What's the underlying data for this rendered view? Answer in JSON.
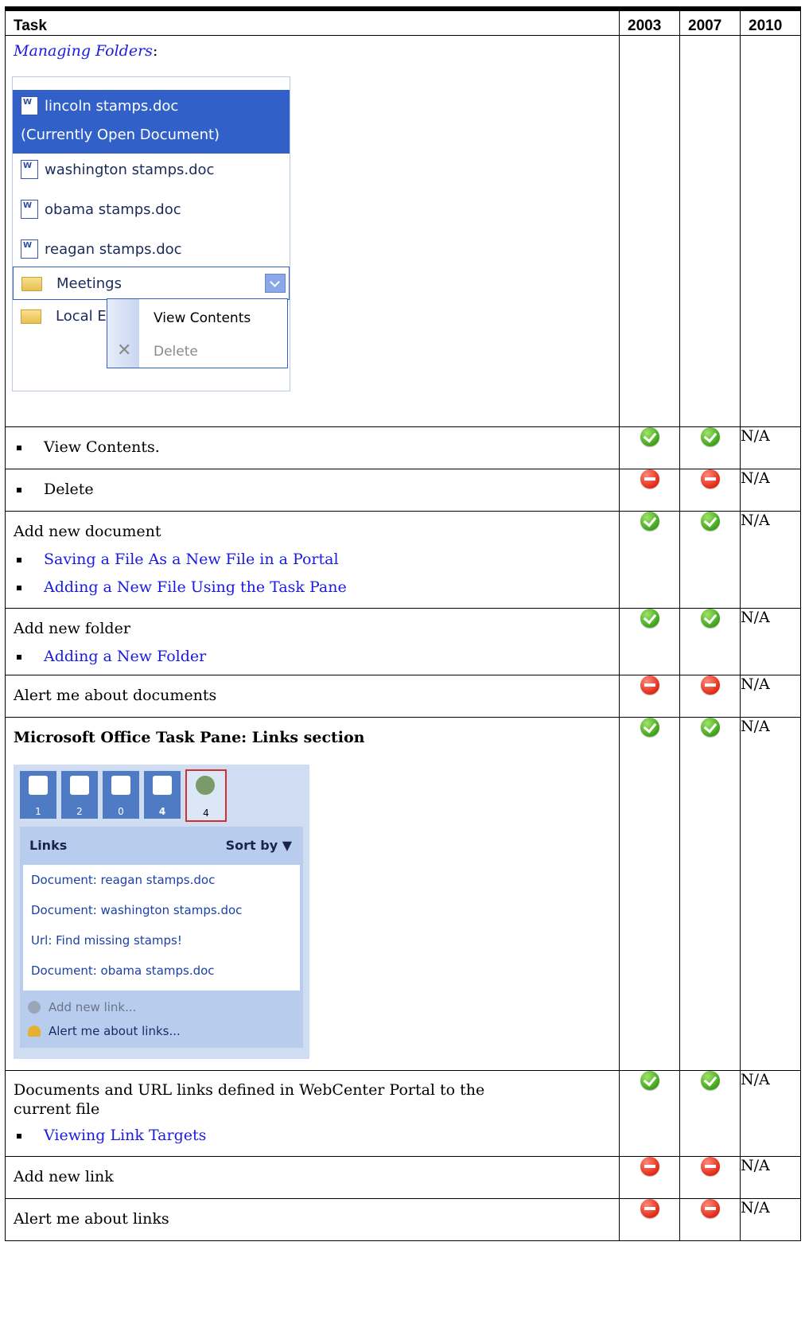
{
  "header": {
    "task": "Task",
    "y2003": "2003",
    "y2007": "2007",
    "y2010": "2010"
  },
  "rows": {
    "managing": {
      "link": "Managing Folders",
      "suffix": ":"
    },
    "view_contents": {
      "text": "View Contents.",
      "na": "N/A",
      "s2003": "supported",
      "s2007": "supported"
    },
    "delete": {
      "text": "Delete",
      "na": "N/A",
      "s2003": "not-supported",
      "s2007": "not-supported"
    },
    "add_doc": {
      "text": "Add new document",
      "link1": "Saving a File As a New File in a Portal",
      "link2": "Adding a New File Using the Task Pane",
      "na": "N/A"
    },
    "add_folder": {
      "text": "Add new folder",
      "link1": "Adding a New Folder",
      "na": "N/A"
    },
    "alert_docs": {
      "text": "Alert me about documents",
      "na": "N/A"
    },
    "taskpane": {
      "text": "Microsoft Office Task Pane: Links section",
      "na": "N/A"
    },
    "doc_links": {
      "text": "Documents and URL links defined in WebCenter Portal to the current file",
      "link1": "Viewing Link Targets",
      "na": "N/A"
    },
    "add_link": {
      "text": "Add new link",
      "na": "N/A"
    },
    "alert_links": {
      "text": "Alert me about links",
      "na": "N/A"
    }
  },
  "shot1": {
    "sel1": "lincoln stamps.doc",
    "sel2": "(Currently Open Document)",
    "doc2": "washington stamps.doc",
    "doc3": "obama stamps.doc",
    "doc4": "reagan stamps.doc",
    "folder1": "Meetings",
    "folder2": "Local E",
    "menu_view": "View Contents",
    "menu_delete": "Delete"
  },
  "shot2": {
    "tabs": [
      "1",
      "2",
      "0",
      "4",
      "4"
    ],
    "title": "Links",
    "sort": "Sort by ▼",
    "items": [
      "Document: reagan stamps.doc",
      "Document: washington stamps.doc",
      "Url: Find missing stamps!",
      "Document: obama stamps.doc"
    ],
    "add": "Add new link...",
    "alert": "Alert me about links..."
  },
  "colors": {
    "supported": "#3fa31a",
    "not_supported": "#e22a16",
    "link": "#1a1ae0"
  }
}
